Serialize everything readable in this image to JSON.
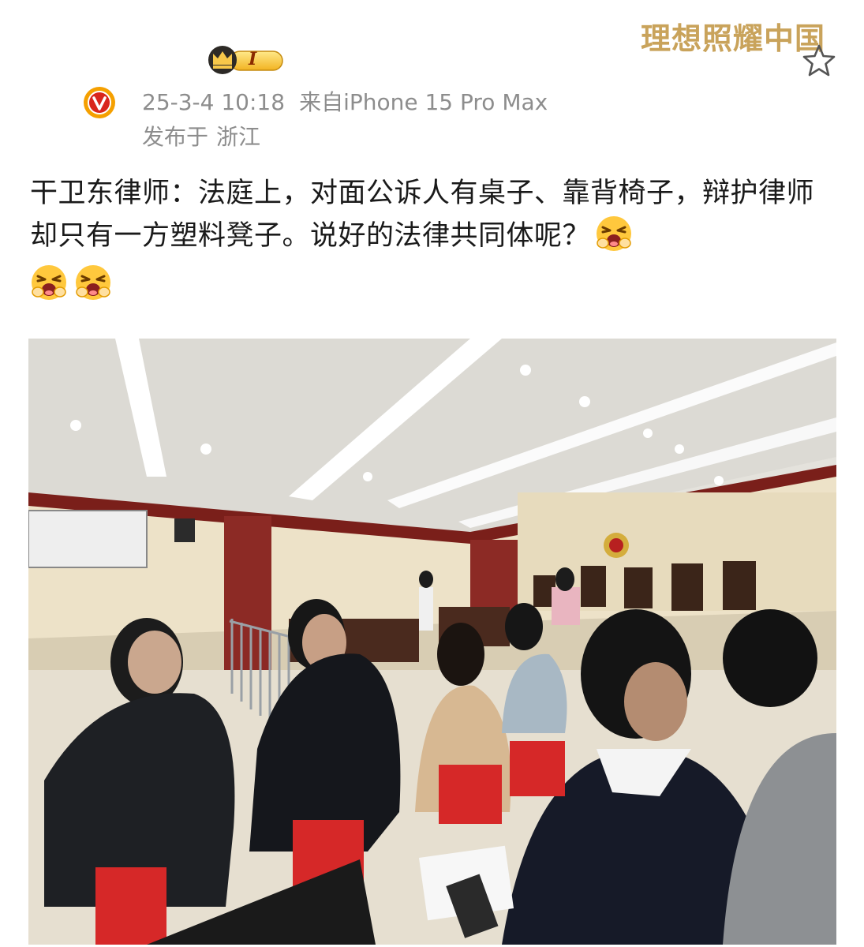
{
  "header": {
    "slogan": "理想照耀中国",
    "favorite_icon": "star-outline-icon",
    "member_badge_letter": "I",
    "member_badge_icon": "crown-badge-icon",
    "verified_icon": "verified-v-icon"
  },
  "post": {
    "timestamp": "25-3-4 10:18",
    "source": "来自iPhone 15 Pro Max",
    "location_prefix": "发布于",
    "location": "浙江",
    "text": "干卫东律师：法庭上，对面公诉人有桌子、靠背椅子，辩护律师却只有一方塑料凳子。说好的法律共同体呢？",
    "emojis": [
      "crying-face-emoji",
      "crying-face-emoji",
      "crying-face-emoji"
    ],
    "image_alt": "courtroom-photo"
  },
  "colors": {
    "slogan": "#c9a35b",
    "meta_text": "#8d8d8d",
    "body_text": "#1a1a1a",
    "verified_orange": "#f5a000",
    "verified_red": "#d9261c"
  }
}
